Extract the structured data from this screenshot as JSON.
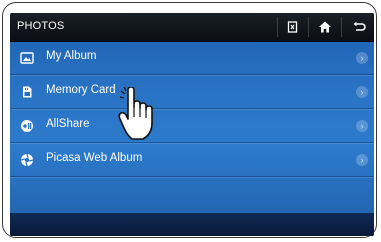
{
  "header": {
    "title": "PHOTOS",
    "icons": [
      "edit-icon",
      "home-icon",
      "back-icon"
    ]
  },
  "list": {
    "items": [
      {
        "label": "My Album",
        "icon": "album-icon"
      },
      {
        "label": "Memory Card",
        "icon": "memory-card-icon"
      },
      {
        "label": "AllShare",
        "icon": "allshare-icon"
      },
      {
        "label": "Picasa Web Album",
        "icon": "picasa-icon"
      }
    ],
    "chevron": "›"
  },
  "colors": {
    "list_bg": "#2a73c4",
    "header_bg": "#10141a",
    "text": "#ffffff"
  }
}
